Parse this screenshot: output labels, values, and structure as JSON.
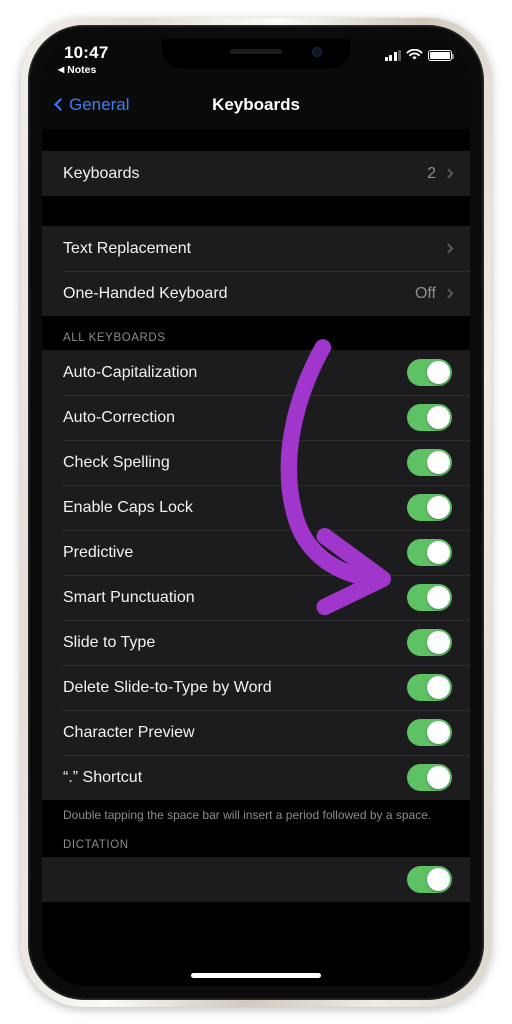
{
  "status_bar": {
    "time": "10:47",
    "back_app_label": "Notes",
    "back_app_triangle": "◀",
    "signal_icon": "cellular-signal-icon",
    "wifi_icon": "wifi-icon",
    "battery_icon": "battery-icon"
  },
  "nav_bar": {
    "back_label": "General",
    "title": "Keyboards"
  },
  "groups": [
    {
      "rows": [
        {
          "label": "Keyboards",
          "value": "2",
          "type": "disclosure"
        }
      ]
    },
    {
      "rows": [
        {
          "label": "Text Replacement",
          "value": "",
          "type": "disclosure"
        },
        {
          "label": "One-Handed Keyboard",
          "value": "Off",
          "type": "disclosure"
        }
      ]
    }
  ],
  "all_keyboards": {
    "header": "ALL KEYBOARDS",
    "rows": [
      {
        "label": "Auto-Capitalization",
        "on": true
      },
      {
        "label": "Auto-Correction",
        "on": true
      },
      {
        "label": "Check Spelling",
        "on": true
      },
      {
        "label": "Enable Caps Lock",
        "on": true
      },
      {
        "label": "Predictive",
        "on": true
      },
      {
        "label": "Smart Punctuation",
        "on": true
      },
      {
        "label": "Slide to Type",
        "on": true
      },
      {
        "label": "Delete Slide-to-Type by Word",
        "on": true
      },
      {
        "label": "Character Preview",
        "on": true
      },
      {
        "label": "“.” Shortcut",
        "on": true
      }
    ],
    "footer": "Double tapping the space bar will insert a period followed by a space."
  },
  "dictation": {
    "header": "DICTATION",
    "rows": [
      {
        "label": "",
        "on": true
      }
    ]
  },
  "annotation": {
    "name": "purple-arrow",
    "points_to": "Predictive",
    "color": "#a136cc"
  },
  "colors": {
    "accent_blue": "#3b7ff0",
    "toggle_green": "#5ec264",
    "row_background": "#1c1c1e",
    "screen_background": "#000000",
    "secondary_text": "#8c8c90"
  }
}
